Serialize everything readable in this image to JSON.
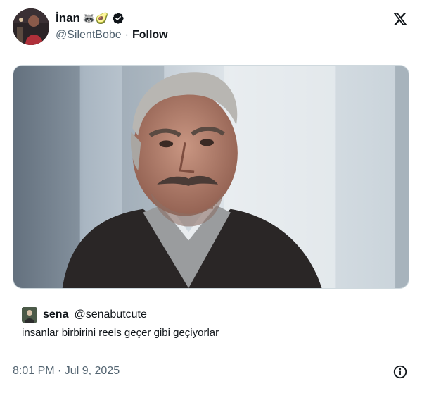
{
  "author": {
    "display_name": "İnan",
    "emojis": "🦝🥑",
    "handle": "@SilentBobe",
    "separator": "·",
    "follow_label": "Follow"
  },
  "icons": {
    "brand": "x-logo-icon",
    "verified": "verified-badge-icon",
    "info": "info-icon"
  },
  "colors": {
    "text_primary": "#0f1419",
    "text_secondary": "#536471",
    "verified_badge": "#0f1419",
    "border": "#cfd9de"
  },
  "quote": {
    "name": "sena",
    "handle": "@senabutcute",
    "text": "insanlar birbirini reels geçer gibi geçiyorlar"
  },
  "footer": {
    "timestamp": "8:01 PM · Jul 9, 2025"
  }
}
